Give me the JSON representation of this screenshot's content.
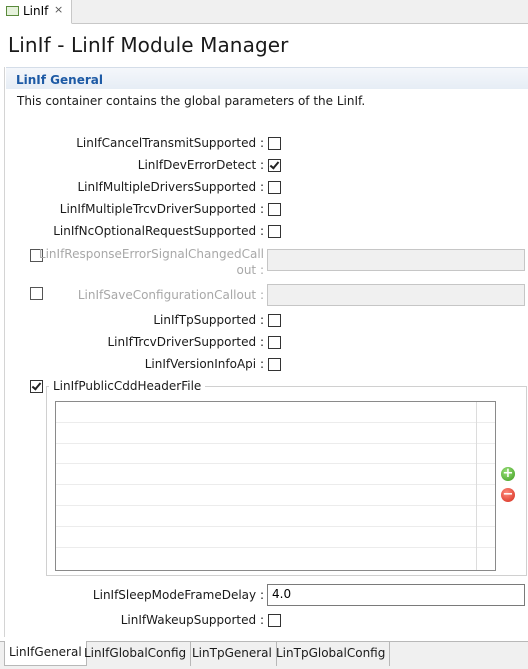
{
  "editor_tab": {
    "label": "LinIf",
    "close_icon": "×"
  },
  "page_title": "LinIf - LinIf Module Manager",
  "section": {
    "title": "LinIf General",
    "description": "This container contains the global parameters of the LinIf."
  },
  "params": {
    "cancel_transmit": {
      "label": "LinIfCancelTransmitSupported :",
      "checked": false
    },
    "dev_error_detect": {
      "label": "LinIfDevErrorDetect :",
      "checked": true
    },
    "multiple_drivers": {
      "label": "LinIfMultipleDriversSupported :",
      "checked": false
    },
    "multiple_trcv": {
      "label": "LinIfMultipleTrcvDriverSupported :",
      "checked": false
    },
    "nc_optional": {
      "label": "LinIfNcOptionalRequestSupported :",
      "checked": false
    },
    "response_error": {
      "label_line1": "LinIfResponseErrorSignalChangedCall",
      "label_line2": "out :",
      "enabled": false,
      "value": ""
    },
    "save_config": {
      "label": "LinIfSaveConfigurationCallout :",
      "enabled": false,
      "value": ""
    },
    "tp_supported": {
      "label": "LinIfTpSupported :",
      "checked": false
    },
    "trcv_driver": {
      "label": "LinIfTrcvDriverSupported :",
      "checked": false
    },
    "version_info": {
      "label": "LinIfVersionInfoApi :",
      "checked": false
    },
    "public_cdd": {
      "label": "LinIfPublicCddHeaderFile",
      "checked": true,
      "rows": 8
    },
    "sleep_mode_delay": {
      "label": "LinIfSleepModeFrameDelay :",
      "value": "4.0"
    },
    "wakeup": {
      "label": "LinIfWakeupSupported :",
      "checked": false
    }
  },
  "bottom_tabs": [
    "LinIfGeneral",
    "LinIfGlobalConfig",
    "LinTpGeneral",
    "LinTpGlobalConfig"
  ],
  "active_bottom_tab": "LinIfGeneral",
  "icons": {
    "editor_tab": "module-icon",
    "add": "add-icon",
    "remove": "remove-icon"
  },
  "colors": {
    "section_title": "#1d5aa5",
    "add": "#3c9a1e",
    "remove": "#d42a1c"
  }
}
